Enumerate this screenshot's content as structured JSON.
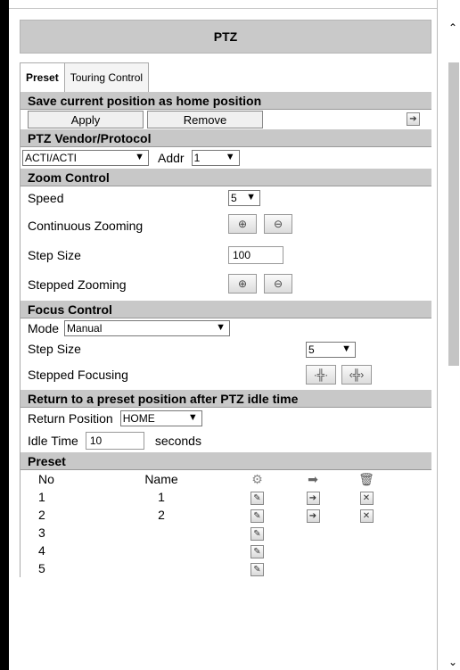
{
  "title": "PTZ",
  "tabs": [
    "Preset",
    "Touring Control"
  ],
  "home": {
    "header": "Save current position as home position",
    "apply": "Apply",
    "remove": "Remove"
  },
  "vendor": {
    "header": "PTZ Vendor/Protocol",
    "vendor_value": "ACTI/ACTI",
    "addr_label": "Addr",
    "addr_value": "1"
  },
  "zoom": {
    "header": "Zoom Control",
    "speed_label": "Speed",
    "speed_value": "5",
    "continuous_label": "Continuous Zooming",
    "step_size_label": "Step Size",
    "step_size_value": "100",
    "stepped_label": "Stepped Zooming"
  },
  "focus": {
    "header": "Focus Control",
    "mode_label": "Mode",
    "mode_value": "Manual",
    "step_size_label": "Step Size",
    "step_size_value": "5",
    "stepped_label": "Stepped Focusing"
  },
  "idle": {
    "header": "Return to a preset position after PTZ idle time",
    "return_label": "Return Position",
    "return_value": "HOME",
    "idle_label": "Idle Time",
    "idle_value": "10",
    "seconds_label": "seconds"
  },
  "preset": {
    "header": "Preset",
    "col_no": "No",
    "col_name": "Name",
    "rows": [
      {
        "no": "1",
        "name": "1"
      },
      {
        "no": "2",
        "name": "2"
      },
      {
        "no": "3",
        "name": ""
      },
      {
        "no": "4",
        "name": ""
      },
      {
        "no": "5",
        "name": ""
      }
    ]
  }
}
